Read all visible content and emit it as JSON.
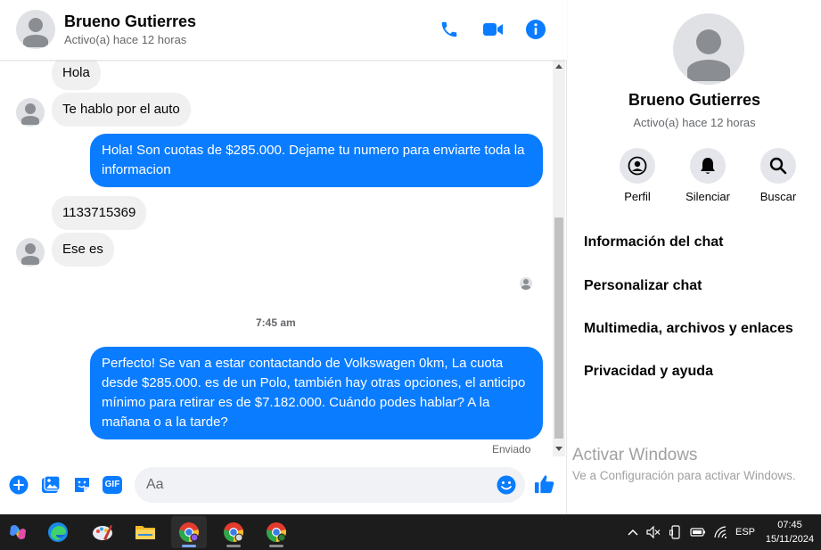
{
  "header": {
    "contact_name": "Brueno Gutierres",
    "status": "Activo(a) hace 12 horas"
  },
  "messages": {
    "in_1": "Hola",
    "in_2": "Te hablo por el auto",
    "out_1": "Hola! Son cuotas de $285.000. Dejame tu numero para enviarte toda la informacion",
    "in_3": "1133715369",
    "in_4": "Ese es",
    "timestamp": "7:45 am",
    "out_2": "Perfecto!  Se van a estar contactando de Volkswagen 0km, La cuota desde $285.000. es de un Polo, también hay otras opciones, el anticipo mínimo para retirar es de $7.182.000. Cuándo podes hablar? A la mañana o a la tarde?",
    "delivery_status": "Enviado"
  },
  "composer": {
    "placeholder": "Aa",
    "gif_label": "GIF"
  },
  "info_panel": {
    "name": "Brueno Gutierres",
    "status": "Activo(a) hace 12 horas",
    "actions": [
      "Perfil",
      "Silenciar",
      "Buscar"
    ],
    "menu": [
      "Información del chat",
      "Personalizar chat",
      "Multimedia, archivos y enlaces",
      "Privacidad y ayuda"
    ]
  },
  "watermark": {
    "title": "Activar Windows",
    "subtitle": "Ve a Configuración para activar Windows."
  },
  "taskbar": {
    "language": "ESP",
    "time": "07:45",
    "date": "15/11/2024"
  },
  "colors": {
    "accent": "#0a7cff",
    "incoming_bubble": "#f0f0f0",
    "taskbar": "#1c1c1c"
  }
}
